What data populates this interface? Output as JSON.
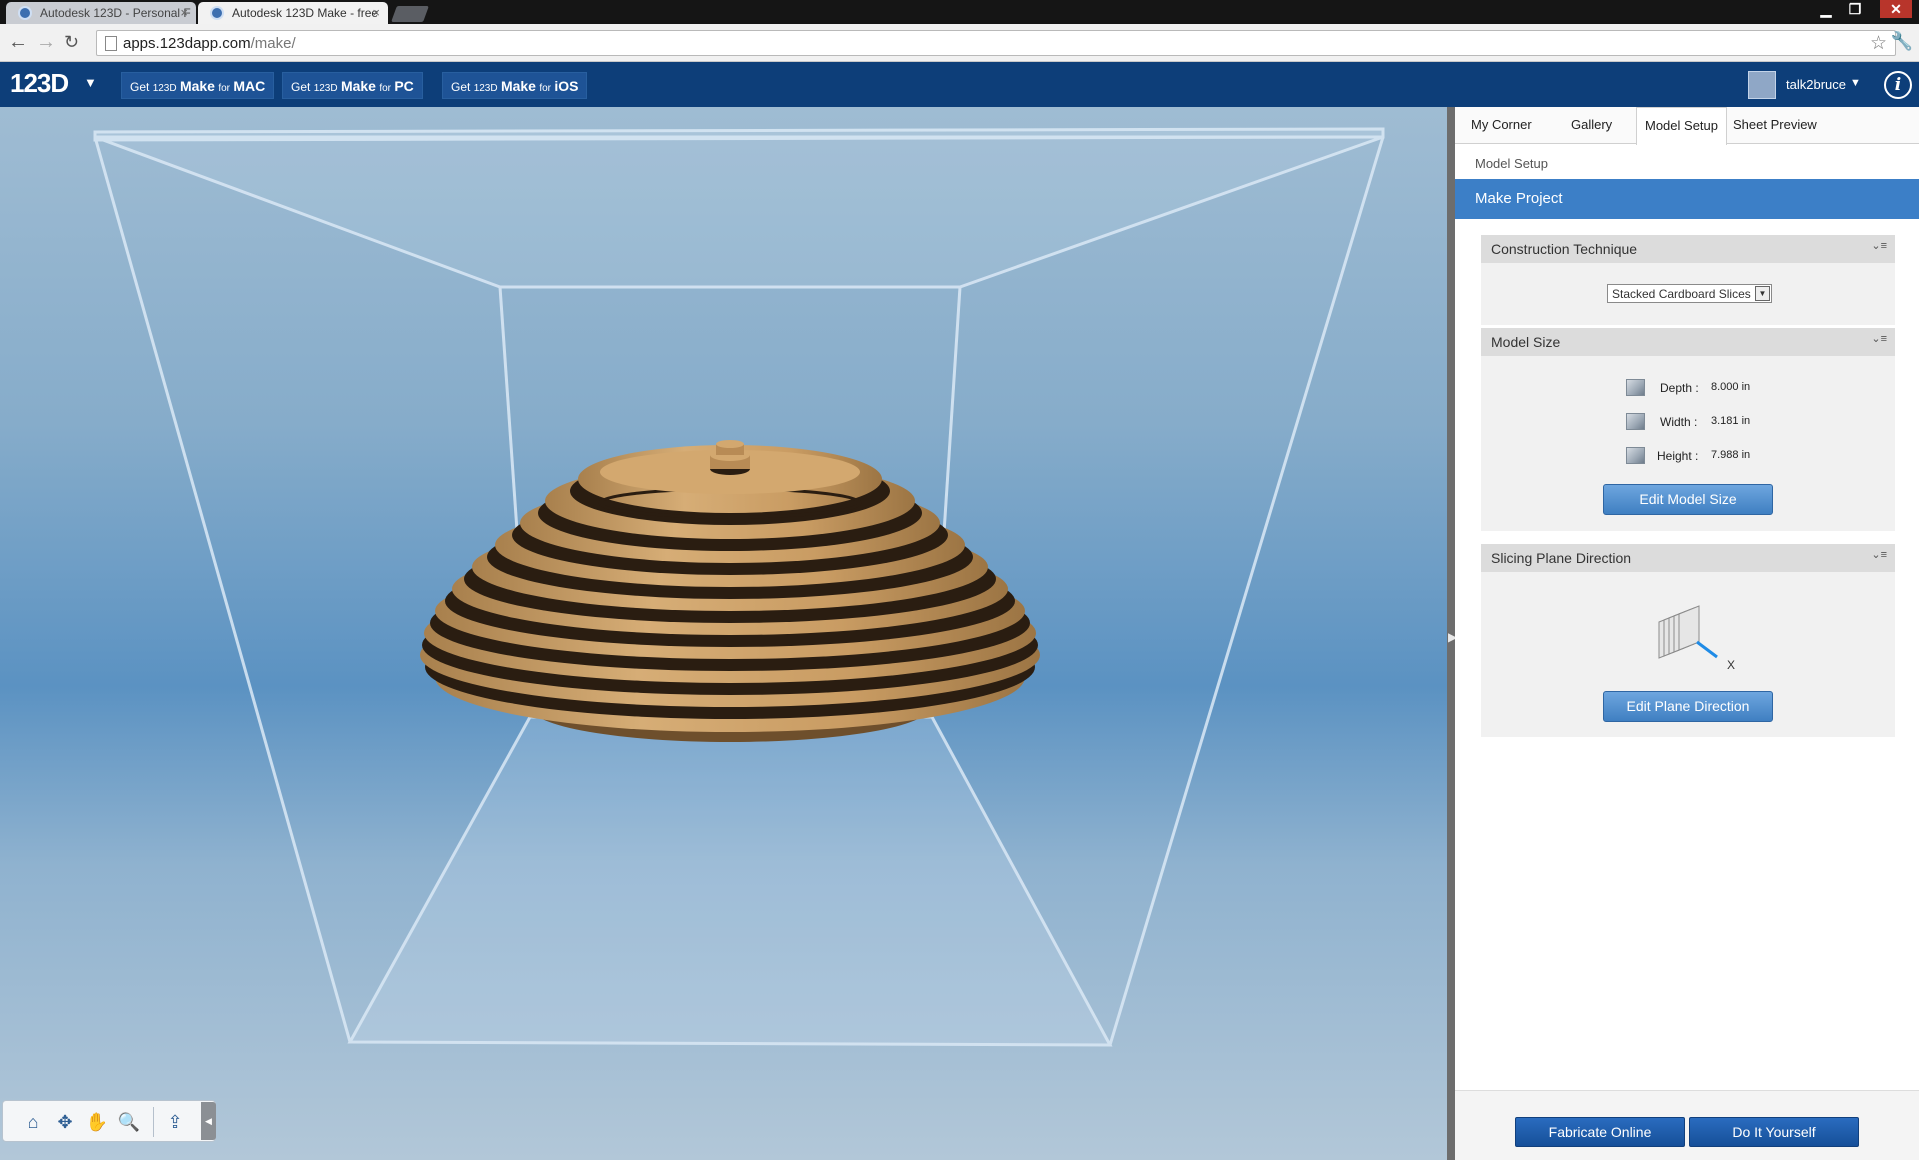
{
  "browser": {
    "tabs": [
      {
        "title": "Autodesk 123D - Personal F",
        "active": false
      },
      {
        "title": "Autodesk 123D Make - free",
        "active": true
      }
    ],
    "url_host": "apps.123dapp.com",
    "url_path": "/make/",
    "window_controls": {
      "minimize": "▁",
      "restore": "❐",
      "close": "✕"
    }
  },
  "header": {
    "logo": "123D",
    "get_buttons": [
      {
        "prefix": "Get",
        "brand": "123D",
        "product": "Make",
        "for": "for",
        "platform": "MAC"
      },
      {
        "prefix": "Get",
        "brand": "123D",
        "product": "Make",
        "for": "for",
        "platform": "PC"
      },
      {
        "prefix": "Get",
        "brand": "123D",
        "product": "Make",
        "for": "for",
        "platform": "iOS"
      }
    ],
    "username": "talk2bruce",
    "info_label": "i"
  },
  "panel": {
    "tabs": [
      "My Corner",
      "Gallery",
      "Model Setup",
      "Sheet Preview"
    ],
    "active_tab": "Model Setup",
    "breadcrumb": "Model Setup",
    "title": "Make Project",
    "construction": {
      "heading": "Construction Technique",
      "selected": "Stacked Cardboard Slices"
    },
    "model_size": {
      "heading": "Model Size",
      "depth_label": "Depth :",
      "depth_value": "8.000 in",
      "width_label": "Width :",
      "width_value": "3.181 in",
      "height_label": "Height :",
      "height_value": "7.988 in",
      "edit_button": "Edit Model Size"
    },
    "slicing": {
      "heading": "Slicing Plane Direction",
      "axis_label": "X",
      "edit_button": "Edit Plane Direction"
    },
    "footer": {
      "fabricate": "Fabricate Online",
      "diy": "Do It Yourself"
    }
  },
  "colors": {
    "appbar": "#0d3e79",
    "accent": "#3c7fc7",
    "cardboard": "#c79a62"
  },
  "icons": [
    "home-icon",
    "orbit-icon",
    "pan-icon",
    "zoom-icon",
    "share-icon"
  ]
}
